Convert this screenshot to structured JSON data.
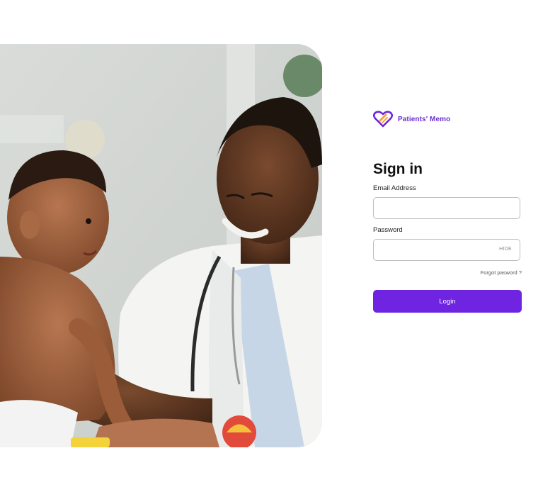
{
  "brand": {
    "name": "Patients' Memo",
    "icon": "heart-logo-icon",
    "accent": "#6e24e0"
  },
  "auth": {
    "title": "Sign in",
    "email": {
      "label": "Email Address",
      "value": "",
      "placeholder": ""
    },
    "password": {
      "label": "Password",
      "value": "",
      "placeholder": "",
      "toggle_label": "HIDE"
    },
    "forgot_label": "Forgot pasword ?",
    "login_label": "Login"
  },
  "hero": {
    "alt": "Doctor smiling with a baby"
  }
}
